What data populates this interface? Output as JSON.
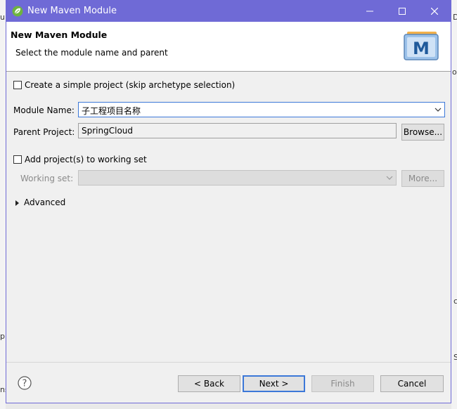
{
  "background": {
    "fragments": [
      "u",
      "ol",
      "D",
      "ok",
      "c",
      "s",
      "p",
      "S",
      "ns"
    ]
  },
  "window": {
    "title": "New Maven Module",
    "icons": [
      "spring-leaf-icon",
      "minimize-icon",
      "maximize-icon",
      "close-icon"
    ]
  },
  "banner": {
    "title": "New Maven Module",
    "subtitle": "Select the module name and parent",
    "logo_letter": "M"
  },
  "form": {
    "simple_project": {
      "label": "Create a simple project (skip archetype selection)",
      "checked": false
    },
    "module_name": {
      "label": "Module Name:",
      "value": "子工程项目名称"
    },
    "parent_project": {
      "label": "Parent Project:",
      "value": "SpringCloud",
      "browse_label": "Browse..."
    },
    "working_set_toggle": {
      "label": "Add project(s) to working set",
      "checked": false
    },
    "working_set": {
      "label": "Working set:",
      "value": "",
      "more_label": "More..."
    },
    "advanced_label": "Advanced"
  },
  "footer": {
    "back_label": "< Back",
    "next_label": "Next >",
    "finish_label": "Finish",
    "cancel_label": "Cancel"
  },
  "colors": {
    "titlebar": "#6f6ad6",
    "focus": "#3c78d8"
  }
}
